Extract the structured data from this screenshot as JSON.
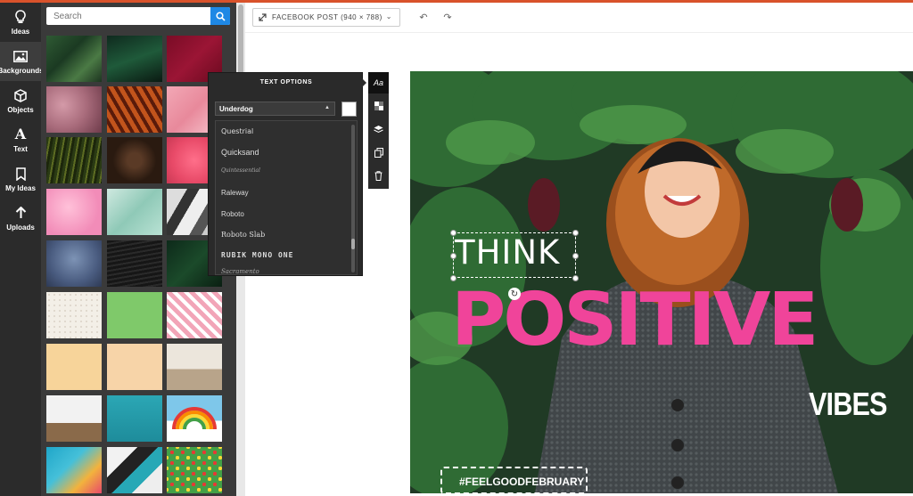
{
  "rail": {
    "items": [
      {
        "label": "Ideas",
        "icon": "lightbulb-icon"
      },
      {
        "label": "Backgrounds",
        "icon": "image-icon"
      },
      {
        "label": "Objects",
        "icon": "cube-icon"
      },
      {
        "label": "Text",
        "icon": "text-icon"
      },
      {
        "label": "My Ideas",
        "icon": "bookmark-icon"
      },
      {
        "label": "Uploads",
        "icon": "upload-icon"
      }
    ]
  },
  "search": {
    "placeholder": "Search"
  },
  "toolbar": {
    "size_label": "FACEBOOK POST (940 × 788)"
  },
  "text_options": {
    "title": "TEXT OPTIONS",
    "selected_font": "Underdog",
    "fonts": [
      "Questrial",
      "Quicksand",
      "Quintessential",
      "Raleway",
      "Roboto",
      "Roboto Slab",
      "RUBIK MONO ONE",
      "Sacramento"
    ]
  },
  "poster": {
    "headline_top": "THINK",
    "headline_main": "POSITIVE",
    "headline_bottom": "VIBES",
    "hashtag": "#FEELGOODFEBRUARY"
  },
  "colors": {
    "accent": "#1e88e5",
    "pink": "#f0449a",
    "rail": "#2b2b2b"
  }
}
